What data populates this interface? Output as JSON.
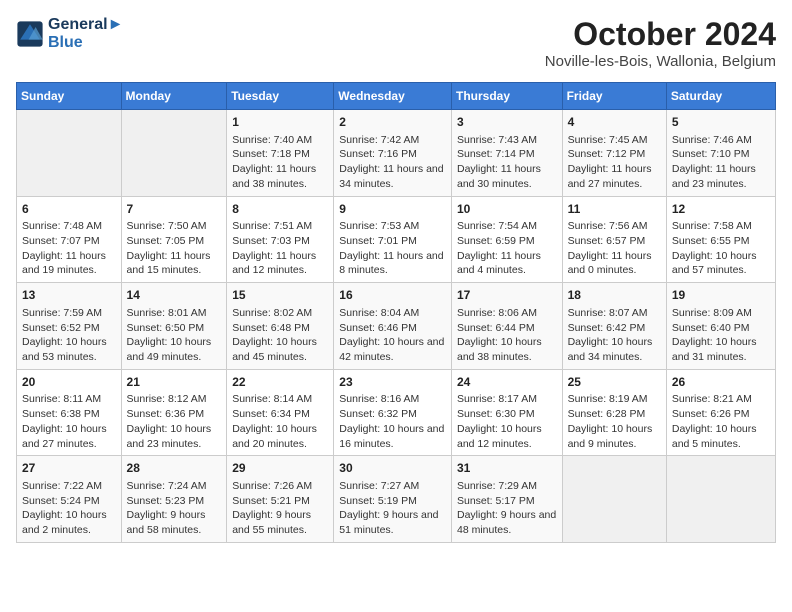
{
  "header": {
    "logo_line1": "General",
    "logo_line2": "Blue",
    "title": "October 2024",
    "subtitle": "Noville-les-Bois, Wallonia, Belgium"
  },
  "days_of_week": [
    "Sunday",
    "Monday",
    "Tuesday",
    "Wednesday",
    "Thursday",
    "Friday",
    "Saturday"
  ],
  "weeks": [
    [
      {
        "day": "",
        "content": ""
      },
      {
        "day": "",
        "content": ""
      },
      {
        "day": "1",
        "content": "Sunrise: 7:40 AM\nSunset: 7:18 PM\nDaylight: 11 hours and 38 minutes."
      },
      {
        "day": "2",
        "content": "Sunrise: 7:42 AM\nSunset: 7:16 PM\nDaylight: 11 hours and 34 minutes."
      },
      {
        "day": "3",
        "content": "Sunrise: 7:43 AM\nSunset: 7:14 PM\nDaylight: 11 hours and 30 minutes."
      },
      {
        "day": "4",
        "content": "Sunrise: 7:45 AM\nSunset: 7:12 PM\nDaylight: 11 hours and 27 minutes."
      },
      {
        "day": "5",
        "content": "Sunrise: 7:46 AM\nSunset: 7:10 PM\nDaylight: 11 hours and 23 minutes."
      }
    ],
    [
      {
        "day": "6",
        "content": "Sunrise: 7:48 AM\nSunset: 7:07 PM\nDaylight: 11 hours and 19 minutes."
      },
      {
        "day": "7",
        "content": "Sunrise: 7:50 AM\nSunset: 7:05 PM\nDaylight: 11 hours and 15 minutes."
      },
      {
        "day": "8",
        "content": "Sunrise: 7:51 AM\nSunset: 7:03 PM\nDaylight: 11 hours and 12 minutes."
      },
      {
        "day": "9",
        "content": "Sunrise: 7:53 AM\nSunset: 7:01 PM\nDaylight: 11 hours and 8 minutes."
      },
      {
        "day": "10",
        "content": "Sunrise: 7:54 AM\nSunset: 6:59 PM\nDaylight: 11 hours and 4 minutes."
      },
      {
        "day": "11",
        "content": "Sunrise: 7:56 AM\nSunset: 6:57 PM\nDaylight: 11 hours and 0 minutes."
      },
      {
        "day": "12",
        "content": "Sunrise: 7:58 AM\nSunset: 6:55 PM\nDaylight: 10 hours and 57 minutes."
      }
    ],
    [
      {
        "day": "13",
        "content": "Sunrise: 7:59 AM\nSunset: 6:52 PM\nDaylight: 10 hours and 53 minutes."
      },
      {
        "day": "14",
        "content": "Sunrise: 8:01 AM\nSunset: 6:50 PM\nDaylight: 10 hours and 49 minutes."
      },
      {
        "day": "15",
        "content": "Sunrise: 8:02 AM\nSunset: 6:48 PM\nDaylight: 10 hours and 45 minutes."
      },
      {
        "day": "16",
        "content": "Sunrise: 8:04 AM\nSunset: 6:46 PM\nDaylight: 10 hours and 42 minutes."
      },
      {
        "day": "17",
        "content": "Sunrise: 8:06 AM\nSunset: 6:44 PM\nDaylight: 10 hours and 38 minutes."
      },
      {
        "day": "18",
        "content": "Sunrise: 8:07 AM\nSunset: 6:42 PM\nDaylight: 10 hours and 34 minutes."
      },
      {
        "day": "19",
        "content": "Sunrise: 8:09 AM\nSunset: 6:40 PM\nDaylight: 10 hours and 31 minutes."
      }
    ],
    [
      {
        "day": "20",
        "content": "Sunrise: 8:11 AM\nSunset: 6:38 PM\nDaylight: 10 hours and 27 minutes."
      },
      {
        "day": "21",
        "content": "Sunrise: 8:12 AM\nSunset: 6:36 PM\nDaylight: 10 hours and 23 minutes."
      },
      {
        "day": "22",
        "content": "Sunrise: 8:14 AM\nSunset: 6:34 PM\nDaylight: 10 hours and 20 minutes."
      },
      {
        "day": "23",
        "content": "Sunrise: 8:16 AM\nSunset: 6:32 PM\nDaylight: 10 hours and 16 minutes."
      },
      {
        "day": "24",
        "content": "Sunrise: 8:17 AM\nSunset: 6:30 PM\nDaylight: 10 hours and 12 minutes."
      },
      {
        "day": "25",
        "content": "Sunrise: 8:19 AM\nSunset: 6:28 PM\nDaylight: 10 hours and 9 minutes."
      },
      {
        "day": "26",
        "content": "Sunrise: 8:21 AM\nSunset: 6:26 PM\nDaylight: 10 hours and 5 minutes."
      }
    ],
    [
      {
        "day": "27",
        "content": "Sunrise: 7:22 AM\nSunset: 5:24 PM\nDaylight: 10 hours and 2 minutes."
      },
      {
        "day": "28",
        "content": "Sunrise: 7:24 AM\nSunset: 5:23 PM\nDaylight: 9 hours and 58 minutes."
      },
      {
        "day": "29",
        "content": "Sunrise: 7:26 AM\nSunset: 5:21 PM\nDaylight: 9 hours and 55 minutes."
      },
      {
        "day": "30",
        "content": "Sunrise: 7:27 AM\nSunset: 5:19 PM\nDaylight: 9 hours and 51 minutes."
      },
      {
        "day": "31",
        "content": "Sunrise: 7:29 AM\nSunset: 5:17 PM\nDaylight: 9 hours and 48 minutes."
      },
      {
        "day": "",
        "content": ""
      },
      {
        "day": "",
        "content": ""
      }
    ]
  ]
}
